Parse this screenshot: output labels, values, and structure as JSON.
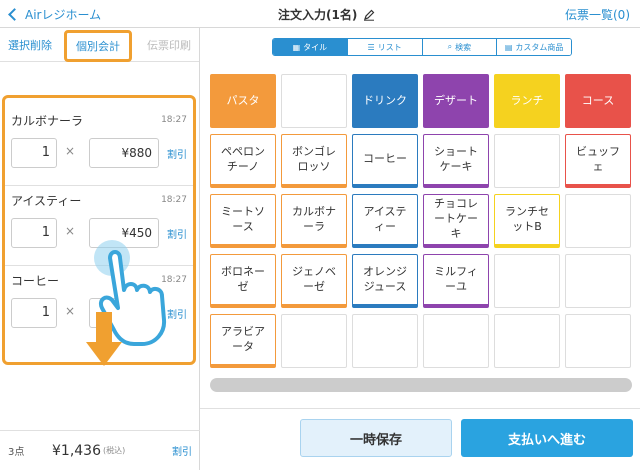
{
  "header": {
    "back_label": "Airレジホーム",
    "title": "注文入力(1名)",
    "slips_label": "伝票一覧(0)"
  },
  "left_panel": {
    "select_delete": "選択削除",
    "individual_checkout": "個別会計",
    "print_slip": "伝票印刷",
    "items": [
      {
        "name": "カルボナーラ",
        "time": "18:27",
        "qty": "1",
        "price": "¥880",
        "discount": "割引"
      },
      {
        "name": "アイスティー",
        "time": "18:27",
        "qty": "1",
        "price": "¥450",
        "discount": "割引"
      },
      {
        "name": "コーヒー",
        "time": "18:27",
        "qty": "1",
        "price": "",
        "discount": "割引"
      }
    ],
    "times_symbol": "×",
    "count": "3点",
    "total": "¥1,436",
    "tax_note": "(税込)",
    "total_discount": "割引"
  },
  "view_tabs": [
    {
      "label": "タイル",
      "icon": "grid-icon",
      "active": true
    },
    {
      "label": "リスト",
      "icon": "list-icon",
      "active": false
    },
    {
      "label": "検索",
      "icon": "search-icon",
      "active": false
    },
    {
      "label": "カスタム商品",
      "icon": "register-icon",
      "active": false
    }
  ],
  "tiles": [
    {
      "label": "パスタ",
      "kind": "cat",
      "color": "#f39a3c"
    },
    {
      "label": "",
      "kind": "empty",
      "color": ""
    },
    {
      "label": "ドリンク",
      "kind": "cat",
      "color": "#2b7bbf"
    },
    {
      "label": "デザート",
      "kind": "cat",
      "color": "#8e44ad"
    },
    {
      "label": "ランチ",
      "kind": "cat",
      "color": "#f5d21f"
    },
    {
      "label": "コース",
      "kind": "cat",
      "color": "#e8524a"
    },
    {
      "label": "ペペロン\nチーノ",
      "kind": "item",
      "color": "#f39a3c"
    },
    {
      "label": "ボンゴレ\nロッソ",
      "kind": "item",
      "color": "#f39a3c"
    },
    {
      "label": "コーヒー",
      "kind": "item",
      "color": "#2b7bbf"
    },
    {
      "label": "ショート\nケーキ",
      "kind": "item",
      "color": "#8e44ad"
    },
    {
      "label": "",
      "kind": "empty",
      "color": ""
    },
    {
      "label": "ビュッフ\nェ",
      "kind": "item",
      "color": "#e8524a"
    },
    {
      "label": "ミートソ\nース",
      "kind": "item",
      "color": "#f39a3c"
    },
    {
      "label": "カルボナ\nーラ",
      "kind": "item",
      "color": "#f39a3c"
    },
    {
      "label": "アイステ\nィー",
      "kind": "item",
      "color": "#2b7bbf"
    },
    {
      "label": "チョコレ\nートケー\nキ",
      "kind": "item",
      "color": "#8e44ad"
    },
    {
      "label": "ランチセ\nットB",
      "kind": "item",
      "color": "#f5d21f"
    },
    {
      "label": "",
      "kind": "empty",
      "color": ""
    },
    {
      "label": "ボロネー\nゼ",
      "kind": "item",
      "color": "#f39a3c"
    },
    {
      "label": "ジェノベ\nーゼ",
      "kind": "item",
      "color": "#f39a3c"
    },
    {
      "label": "オレンジ\nジュース",
      "kind": "item",
      "color": "#2b7bbf"
    },
    {
      "label": "ミルフィ\nーユ",
      "kind": "item",
      "color": "#8e44ad"
    },
    {
      "label": "",
      "kind": "empty",
      "color": ""
    },
    {
      "label": "",
      "kind": "empty",
      "color": ""
    },
    {
      "label": "アラビア\nータ",
      "kind": "item",
      "color": "#f39a3c"
    },
    {
      "label": "",
      "kind": "empty",
      "color": ""
    },
    {
      "label": "",
      "kind": "empty",
      "color": ""
    },
    {
      "label": "",
      "kind": "empty",
      "color": ""
    },
    {
      "label": "",
      "kind": "empty",
      "color": ""
    },
    {
      "label": "",
      "kind": "empty",
      "color": ""
    }
  ],
  "footer": {
    "hold_label": "一時保存",
    "pay_label": "支払いへ進む"
  }
}
